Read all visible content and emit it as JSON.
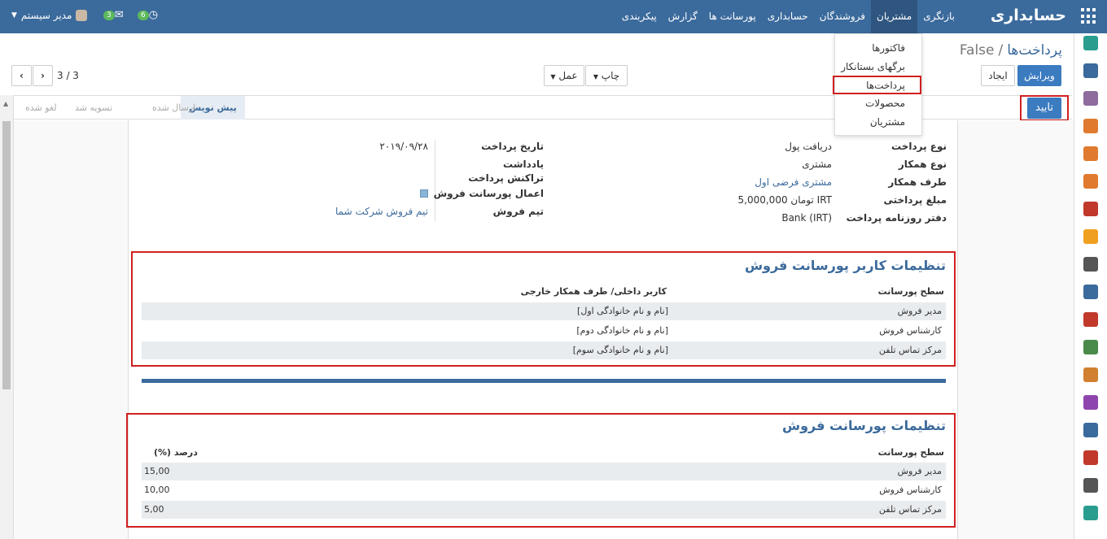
{
  "navbar": {
    "brand": "حسابداری",
    "menu": [
      "بازنگری",
      "مشتریان",
      "فروشندگان",
      "حسابداری",
      "پورسانت ها",
      "گزارش",
      "پیکربندی"
    ],
    "active_menu": "مشتریان",
    "user_name": "مدیر سیستم",
    "messages_count": "3",
    "activities_count": "6"
  },
  "dropdown": {
    "items": [
      "فاکتورها",
      "برگهای بستانکار",
      "پرداخت‌ها",
      "محصولات",
      "مشتریان"
    ],
    "highlighted": "پرداخت‌ها"
  },
  "breadcrumb": {
    "parent": "پرداخت‌ها",
    "separator": "/",
    "current": "False"
  },
  "buttons": {
    "edit": "ویرایش",
    "create": "ایجاد",
    "print": "چاپ",
    "action": "عمل",
    "confirm": "تایید"
  },
  "pager": {
    "text": "3 / 3"
  },
  "statusbar": {
    "stages": [
      "پیش نویس",
      "ارسال شده",
      "تسویه شد",
      "لغو شده"
    ],
    "active": "پیش نویس"
  },
  "form": {
    "right": [
      {
        "label": "نوع پرداخت",
        "value": "دریافت پول"
      },
      {
        "label": "نوع همکار",
        "value": "مشتری"
      },
      {
        "label": "طرف همکار",
        "value": "مشتری فرضی اول"
      },
      {
        "label": "مبلغ پرداختی",
        "value": "5,000,000 تومان IRT"
      },
      {
        "label": "دفتر روزنامه پرداخت",
        "value": "Bank (IRT)"
      }
    ],
    "left": [
      {
        "label": "تاریخ پرداخت",
        "value": "۲۰۱۹/۰۹/۲۸"
      },
      {
        "label": "یادداشت",
        "value": ""
      },
      {
        "label": "تراکنش پرداخت",
        "value": ""
      },
      {
        "label": "اعمال پورسانت فروش",
        "value": ""
      },
      {
        "label": "تیم فروش",
        "value": "تیم فروش شرکت شما"
      }
    ]
  },
  "user_commission": {
    "title": "تنظیمات کاربر پورسانت فروش",
    "headers": [
      "سطح پورسانت",
      "کاربر داخلی/ طرف همکار خارجی"
    ],
    "rows": [
      [
        "مدیر فروش",
        "[نام و نام خانوادگی اول]"
      ],
      [
        "کارشناس فروش",
        "[نام و نام خانوادگی دوم]"
      ],
      [
        "مرکز تماس تلفن",
        "[نام و نام خانوادگی سوم]"
      ]
    ]
  },
  "commission_settings": {
    "title": "تنظیمات پورسانت فروش",
    "headers": [
      "سطح پورسانت",
      "درصد (%)"
    ],
    "rows": [
      [
        "مدیر فروش",
        "15,00"
      ],
      [
        "کارشناس فروش",
        "10,00"
      ],
      [
        "مرکز تماس تلفن",
        "5,00"
      ]
    ]
  },
  "sidebar_colors": [
    "#2a9d8f",
    "#3b6a9c",
    "#8e6c9e",
    "#e07a2e",
    "#e07a2e",
    "#e07a2e",
    "#c0392b",
    "#f0a020",
    "#555555",
    "#3b6a9c",
    "#c0392b",
    "#4a8a4a",
    "#d08030",
    "#8e44ad",
    "#3b6a9c",
    "#c0392b",
    "#555555",
    "#2a9d8f"
  ]
}
